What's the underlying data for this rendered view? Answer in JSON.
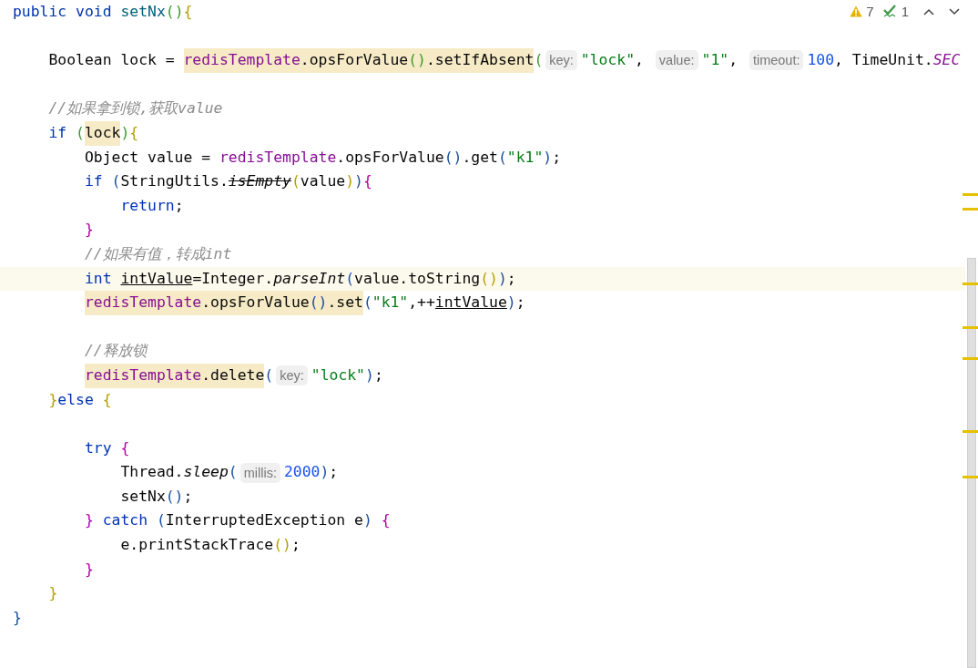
{
  "inspections": {
    "warnings": "7",
    "weak_warnings": "1"
  },
  "lines": [
    {
      "kind": "code",
      "tokens": [
        {
          "kind": "kw",
          "text": "public void "
        },
        {
          "kind": "decl",
          "text": "setNx"
        },
        {
          "kind": "bg",
          "text": "()"
        },
        {
          "kind": "by",
          "text": "{"
        }
      ],
      "children": [
        {
          "kind": "blank"
        },
        {
          "kind": "code",
          "tokens": [
            {
              "kind": "txt",
              "text": "Boolean lock = "
            },
            {
              "kind": "fld",
              "text": "redisTemplate",
              "warn": true
            },
            {
              "kind": "txt",
              "text": ".opsForValue",
              "warn": true
            },
            {
              "kind": "bg",
              "text": "()",
              "warn": true
            },
            {
              "kind": "txt",
              "text": ".setIfAbsent",
              "warn": true
            },
            {
              "kind": "bg",
              "text": "("
            },
            {
              "kind": "hint",
              "text": "key:"
            },
            {
              "kind": "str",
              "text": "\"lock\""
            },
            {
              "kind": "txt",
              "text": ", "
            },
            {
              "kind": "hint",
              "text": "value:"
            },
            {
              "kind": "str",
              "text": "\"1\""
            },
            {
              "kind": "txt",
              "text": ", "
            },
            {
              "kind": "hint",
              "text": "timeout:"
            },
            {
              "kind": "num",
              "text": "100"
            },
            {
              "kind": "txt",
              "text": ", TimeUnit."
            },
            {
              "kind": "sit",
              "text": "SEC"
            }
          ]
        },
        {
          "kind": "blank"
        },
        {
          "kind": "code",
          "tokens": [
            {
              "kind": "cmt",
              "text": "//如果拿到锁,获取value"
            }
          ]
        },
        {
          "kind": "code",
          "tokens": [
            {
              "kind": "kw",
              "text": "if "
            },
            {
              "kind": "bg",
              "text": "("
            },
            {
              "kind": "txt",
              "text": "lock",
              "warn": true
            },
            {
              "kind": "bg",
              "text": ")"
            },
            {
              "kind": "by",
              "text": "{"
            }
          ],
          "children": [
            {
              "kind": "code",
              "tokens": [
                {
                  "kind": "txt",
                  "text": "Object value = "
                },
                {
                  "kind": "fld",
                  "text": "redisTemplate"
                },
                {
                  "kind": "txt",
                  "text": ".opsForValue"
                },
                {
                  "kind": "bb",
                  "text": "()"
                },
                {
                  "kind": "txt",
                  "text": ".get"
                },
                {
                  "kind": "bb",
                  "text": "("
                },
                {
                  "kind": "str",
                  "text": "\"k1\""
                },
                {
                  "kind": "bb",
                  "text": ")"
                },
                {
                  "kind": "txt",
                  "text": ";"
                }
              ]
            },
            {
              "kind": "code",
              "tokens": [
                {
                  "kind": "kw",
                  "text": "if "
                },
                {
                  "kind": "bb",
                  "text": "("
                },
                {
                  "kind": "txt",
                  "text": "StringUtils."
                },
                {
                  "kind": "dep",
                  "text": "isEmpty"
                },
                {
                  "kind": "by",
                  "text": "("
                },
                {
                  "kind": "txt",
                  "text": "value"
                },
                {
                  "kind": "by",
                  "text": ")"
                },
                {
                  "kind": "bb",
                  "text": ")"
                },
                {
                  "kind": "bm",
                  "text": "{"
                }
              ],
              "children": [
                {
                  "kind": "code",
                  "tokens": [
                    {
                      "kind": "kw",
                      "text": "return"
                    },
                    {
                      "kind": "txt",
                      "text": ";"
                    }
                  ]
                }
              ]
            },
            {
              "kind": "code",
              "tokens": [
                {
                  "kind": "bm",
                  "text": "}"
                }
              ]
            },
            {
              "kind": "code",
              "tokens": [
                {
                  "kind": "cmt",
                  "text": "//如果有值，转成int"
                }
              ]
            },
            {
              "kind": "code",
              "current": true,
              "tokens": [
                {
                  "kind": "kw",
                  "text": "int "
                },
                {
                  "kind": "und",
                  "text": "intValue"
                },
                {
                  "kind": "txt",
                  "text": "=Integer."
                },
                {
                  "kind": "it",
                  "text": "parseInt"
                },
                {
                  "kind": "bb",
                  "text": "("
                },
                {
                  "kind": "txt",
                  "text": "value.toString"
                },
                {
                  "kind": "by",
                  "text": "()"
                },
                {
                  "kind": "bb",
                  "text": ")"
                },
                {
                  "kind": "txt",
                  "text": ";"
                }
              ]
            },
            {
              "kind": "code",
              "tokens": [
                {
                  "kind": "fld",
                  "text": "redisTemplate",
                  "warn": true
                },
                {
                  "kind": "txt",
                  "text": ".opsForValue",
                  "warn": true
                },
                {
                  "kind": "bb",
                  "text": "()",
                  "warn": true
                },
                {
                  "kind": "txt",
                  "text": ".set",
                  "warn": true
                },
                {
                  "kind": "bb",
                  "text": "("
                },
                {
                  "kind": "str",
                  "text": "\"k1\""
                },
                {
                  "kind": "txt",
                  "text": ",++"
                },
                {
                  "kind": "und",
                  "text": "intValue"
                },
                {
                  "kind": "bb",
                  "text": ")"
                },
                {
                  "kind": "txt",
                  "text": ";"
                }
              ]
            },
            {
              "kind": "blank"
            },
            {
              "kind": "code",
              "tokens": [
                {
                  "kind": "cmt",
                  "text": "//释放锁"
                }
              ]
            },
            {
              "kind": "code",
              "tokens": [
                {
                  "kind": "fld",
                  "text": "redisTemplate",
                  "warn": true
                },
                {
                  "kind": "txt",
                  "text": ".delete",
                  "warn": true
                },
                {
                  "kind": "bb",
                  "text": "("
                },
                {
                  "kind": "hint",
                  "text": "key:"
                },
                {
                  "kind": "str",
                  "text": "\"lock\""
                },
                {
                  "kind": "bb",
                  "text": ")"
                },
                {
                  "kind": "txt",
                  "text": ";"
                }
              ]
            }
          ]
        },
        {
          "kind": "code",
          "tokens": [
            {
              "kind": "by",
              "text": "}"
            },
            {
              "kind": "kw",
              "text": "else "
            },
            {
              "kind": "by",
              "text": "{"
            }
          ],
          "children": [
            {
              "kind": "blank"
            },
            {
              "kind": "code",
              "tokens": [
                {
                  "kind": "kw",
                  "text": "try "
                },
                {
                  "kind": "bm",
                  "text": "{"
                }
              ],
              "children": [
                {
                  "kind": "code",
                  "tokens": [
                    {
                      "kind": "txt",
                      "text": "Thread."
                    },
                    {
                      "kind": "it",
                      "text": "sleep"
                    },
                    {
                      "kind": "bb",
                      "text": "("
                    },
                    {
                      "kind": "hint",
                      "text": "millis:"
                    },
                    {
                      "kind": "num",
                      "text": "2000"
                    },
                    {
                      "kind": "bb",
                      "text": ")"
                    },
                    {
                      "kind": "txt",
                      "text": ";"
                    }
                  ]
                },
                {
                  "kind": "code",
                  "tokens": [
                    {
                      "kind": "txt",
                      "text": "setNx"
                    },
                    {
                      "kind": "bb",
                      "text": "()"
                    },
                    {
                      "kind": "txt",
                      "text": ";"
                    }
                  ]
                }
              ]
            },
            {
              "kind": "code",
              "tokens": [
                {
                  "kind": "bm",
                  "text": "} "
                },
                {
                  "kind": "kw",
                  "text": "catch "
                },
                {
                  "kind": "bb",
                  "text": "("
                },
                {
                  "kind": "txt",
                  "text": "InterruptedException e"
                },
                {
                  "kind": "bb",
                  "text": ")"
                },
                {
                  "kind": "bm",
                  "text": " {"
                }
              ],
              "children": [
                {
                  "kind": "code",
                  "tokens": [
                    {
                      "kind": "txt",
                      "text": "e.printStackTrace"
                    },
                    {
                      "kind": "by",
                      "text": "()"
                    },
                    {
                      "kind": "txt",
                      "text": ";"
                    }
                  ]
                }
              ]
            },
            {
              "kind": "code",
              "tokens": [
                {
                  "kind": "bm",
                  "text": "}"
                }
              ]
            }
          ]
        },
        {
          "kind": "code",
          "tokens": [
            {
              "kind": "by",
              "text": "}"
            }
          ]
        }
      ]
    },
    {
      "kind": "code",
      "tokens": [
        {
          "kind": "bb",
          "text": "}"
        }
      ]
    }
  ]
}
